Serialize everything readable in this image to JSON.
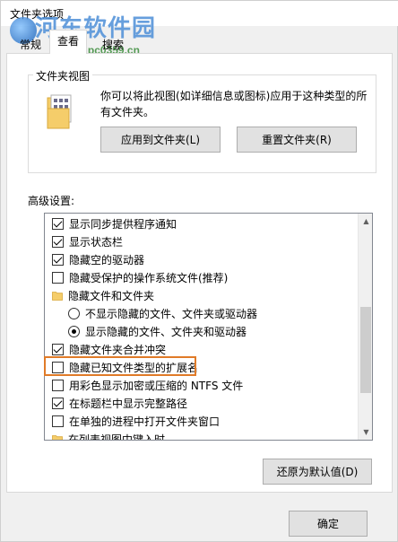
{
  "window": {
    "title": "文件夹选项"
  },
  "watermark": {
    "brand": "河东软件园",
    "url": "www.pc0359.cn"
  },
  "tabs": [
    {
      "label": "常规",
      "active": false
    },
    {
      "label": "查看",
      "active": true
    },
    {
      "label": "搜索",
      "active": false
    }
  ],
  "folder_views": {
    "title": "文件夹视图",
    "description_line1": "你可以将此视图(如详细信息或图标)应用于这种类型的所",
    "description_line2": "有文件夹。",
    "apply_button": "应用到文件夹(L)",
    "reset_button": "重置文件夹(R)"
  },
  "advanced": {
    "label": "高级设置:",
    "items": [
      {
        "type": "checkbox",
        "checked": true,
        "label": "显示同步提供程序通知"
      },
      {
        "type": "checkbox",
        "checked": true,
        "label": "显示状态栏"
      },
      {
        "type": "checkbox",
        "checked": true,
        "label": "隐藏空的驱动器"
      },
      {
        "type": "checkbox",
        "checked": false,
        "label": "隐藏受保护的操作系统文件(推荐)"
      },
      {
        "type": "folder",
        "checked": false,
        "label": "隐藏文件和文件夹"
      },
      {
        "type": "radio",
        "checked": false,
        "label": "不显示隐藏的文件、文件夹或驱动器"
      },
      {
        "type": "radio",
        "checked": true,
        "label": "显示隐藏的文件、文件夹和驱动器"
      },
      {
        "type": "checkbox",
        "checked": true,
        "label": "隐藏文件夹合并冲突"
      },
      {
        "type": "checkbox",
        "checked": false,
        "label": "隐藏已知文件类型的扩展名",
        "highlighted": true
      },
      {
        "type": "checkbox",
        "checked": false,
        "label": "用彩色显示加密或压缩的 NTFS 文件"
      },
      {
        "type": "checkbox",
        "checked": true,
        "label": "在标题栏中显示完整路径"
      },
      {
        "type": "checkbox",
        "checked": false,
        "label": "在单独的进程中打开文件夹窗口"
      },
      {
        "type": "folder",
        "checked": false,
        "label": "在列表视图中键入时"
      }
    ],
    "restore_button": "还原为默认值(D)"
  },
  "footer": {
    "ok_button": "确定"
  },
  "colors": {
    "highlight": "#e07b28",
    "folder": "#f5cd6a"
  }
}
